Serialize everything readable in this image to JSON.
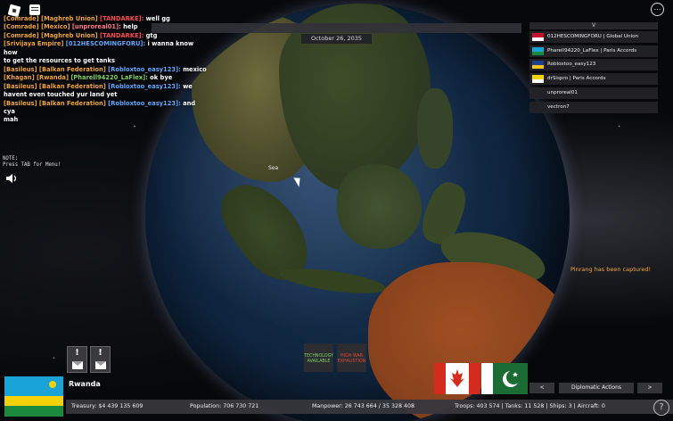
{
  "date": "October 26, 2035",
  "sea_label": "Sea",
  "chat": [
    {
      "tag": "[Comrade]",
      "tag_color": "orange",
      "tag2": "[Maghreb Union]",
      "tag2_color": "orange",
      "tag3": "[TANDARKE]:",
      "tag3_color": "red",
      "text": " well gg"
    },
    {
      "tag": "[Comrade]",
      "tag_color": "orange",
      "tag2": "[Mexico]",
      "tag2_color": "orange",
      "tag3": "[unproreal01]:",
      "tag3_color": "pink",
      "text": " help"
    },
    {
      "tag": "[Comrade]",
      "tag_color": "orange",
      "tag2": "[Maghreb Union]",
      "tag2_color": "orange",
      "tag3": "[TANDARKE]:",
      "tag3_color": "red",
      "text": " gtg"
    },
    {
      "tag": "[Srivijaya Empire]",
      "tag_color": "orange",
      "tag2": "",
      "tag2_color": "orange",
      "tag3": "[012HESCOMINGFORU]:",
      "tag3_color": "blue",
      "text": " i wanna know how"
    },
    {
      "tag": "",
      "tag_color": "orange",
      "tag2": "",
      "tag2_color": "orange",
      "tag3": "",
      "tag3_color": "orange",
      "text": "to get the resources to get tanks"
    },
    {
      "tag": "[Basileus]",
      "tag_color": "orange",
      "tag2": "[Balkan Federation]",
      "tag2_color": "orange",
      "tag3": "[Robloxtoo_easy123]:",
      "tag3_color": "blue",
      "text": " mexico"
    },
    {
      "tag": "[Khagan]",
      "tag_color": "orange",
      "tag2": "[Rwanda]",
      "tag2_color": "orange",
      "tag3": "[Pharell94220_LaFlex]:",
      "tag3_color": "green",
      "text": " ok bye"
    },
    {
      "tag": "[Basileus]",
      "tag_color": "orange",
      "tag2": "[Balkan Federation]",
      "tag2_color": "orange",
      "tag3": "[Robloxtoo_easy123]:",
      "tag3_color": "blue",
      "text": " we"
    },
    {
      "tag": "",
      "tag_color": "orange",
      "tag2": "",
      "tag2_color": "orange",
      "tag3": "",
      "tag3_color": "orange",
      "text": "havent even touched yur land yet"
    },
    {
      "tag": "[Basileus]",
      "tag_color": "orange",
      "tag2": "[Balkan Federation]",
      "tag2_color": "orange",
      "tag3": "[Robloxtoo_easy123]:",
      "tag3_color": "blue",
      "text": " and cya"
    },
    {
      "tag": "",
      "tag_color": "orange",
      "tag2": "",
      "tag2_color": "orange",
      "tag3": "",
      "tag3_color": "orange",
      "text": "mah"
    }
  ],
  "note": {
    "line1": "NOTE:",
    "line2": "Press TAB for Menu!"
  },
  "player_list": {
    "header": "V",
    "rows": [
      {
        "label": "012HESCOMINGFORU  |  Global Union",
        "flag": "srivijaya"
      },
      {
        "label": "Pharell94220_LaFlex  |  Paris Accords",
        "flag": "rwanda"
      },
      {
        "label": "Robloxtoo_easy123",
        "flag": "balkan"
      },
      {
        "label": "drSispro  |  Paris Accords",
        "flag": "vatican"
      },
      {
        "label": "unproreal01",
        "flag": ""
      },
      {
        "label": "vectron7",
        "flag": ""
      }
    ]
  },
  "notification": "Pinrang has been captured!",
  "alerts": [
    {
      "bang": "!"
    },
    {
      "bang": "!"
    }
  ],
  "tech_boxes": [
    {
      "label": "TECHNOLOGY AVAILABLE",
      "color": "#7fd060"
    },
    {
      "label": "HIGH WAR EXHAUSTION",
      "color": "#e04a3a"
    }
  ],
  "country": {
    "name": "Rwanda"
  },
  "stats": {
    "treasury": "Treasury:  $4 439 135 609",
    "population": "Population: 706 730 721",
    "manpower": "Manpower:  26 743 664  /  35 328 408",
    "military": "Troops: 403 574  |  Tanks: 11 528  |  Ships: 3  |  Aircraft: 0"
  },
  "diplomacy": {
    "prev": "<",
    "label": "Diplomatic Actions",
    "next": ">"
  },
  "help": "?",
  "colors": {
    "orange": "#f0a63a",
    "blue": "#62a8ff",
    "green": "#7fd060",
    "pink": "#ff7f8e",
    "red": "#ff4d4d"
  }
}
